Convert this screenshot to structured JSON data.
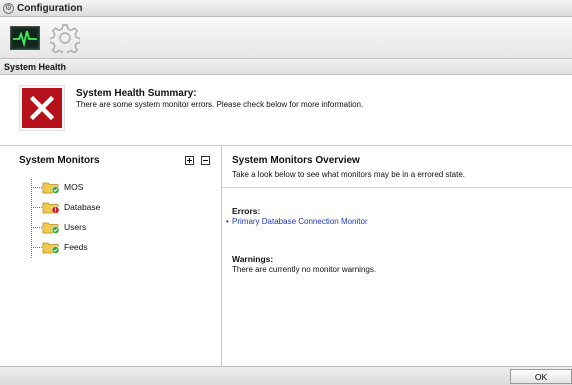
{
  "window": {
    "title": "Configuration"
  },
  "toolbar": {
    "items": [
      "system-health-icon",
      "settings-gear-icon"
    ]
  },
  "section": {
    "title": "System Health"
  },
  "summary": {
    "title": "System Health Summary:",
    "message": "There are some system monitor errors. Please check below for more information.",
    "status_color": "#b5111b"
  },
  "monitors": {
    "title": "System Monitors",
    "items": [
      {
        "label": "MOS",
        "status": "ok"
      },
      {
        "label": "Database",
        "status": "error"
      },
      {
        "label": "Users",
        "status": "ok"
      },
      {
        "label": "Feeds",
        "status": "ok"
      }
    ]
  },
  "overview": {
    "title": "System Monitors Overview",
    "subtitle": "Take a look below to see what monitors may be in a errored state.",
    "errors_heading": "Errors:",
    "errors": [
      "Primary Database Connection Monitor"
    ],
    "warnings_heading": "Warnings:",
    "warnings_text": "There are currently no monitor warnings."
  },
  "footer": {
    "ok_label": "OK"
  },
  "colors": {
    "ok_badge": "#3aa53a",
    "error_badge": "#d0181f",
    "folder": "#f2c94c",
    "link": "#1f37c4"
  }
}
